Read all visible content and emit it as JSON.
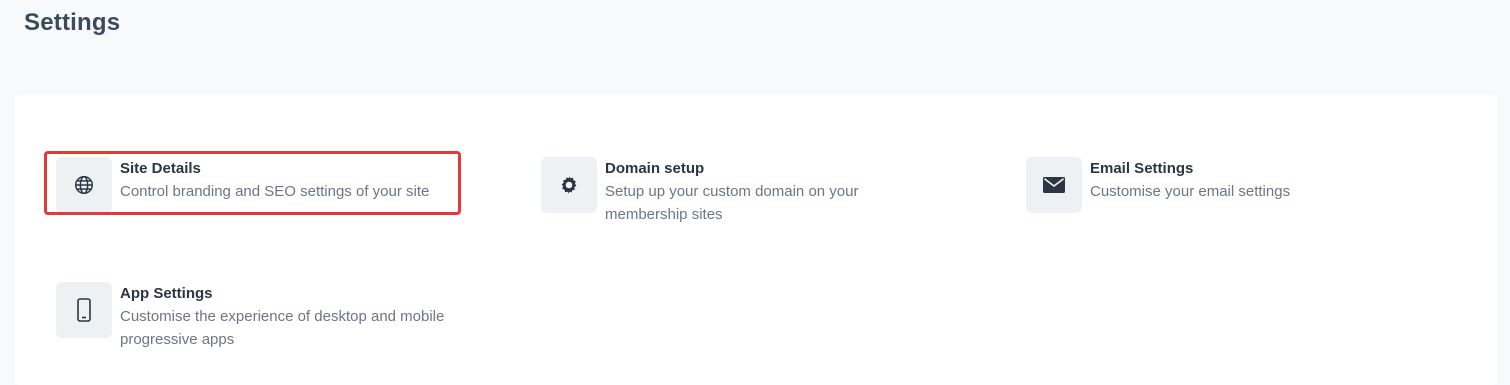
{
  "page": {
    "title": "Settings"
  },
  "settings": [
    {
      "title": "Site Details",
      "description": "Control branding and SEO settings of your site",
      "icon": "globe-icon"
    },
    {
      "title": "Domain setup",
      "description": "Setup up your custom domain on your membership sites",
      "icon": "gear-icon"
    },
    {
      "title": "Email Settings",
      "description": "Customise your email settings",
      "icon": "envelope-icon"
    },
    {
      "title": "App Settings",
      "description": "Customise the experience of desktop and mobile progressive apps",
      "icon": "mobile-phone-icon"
    }
  ],
  "highlight": {
    "target": "Site Details",
    "color": "#e23a3a"
  }
}
